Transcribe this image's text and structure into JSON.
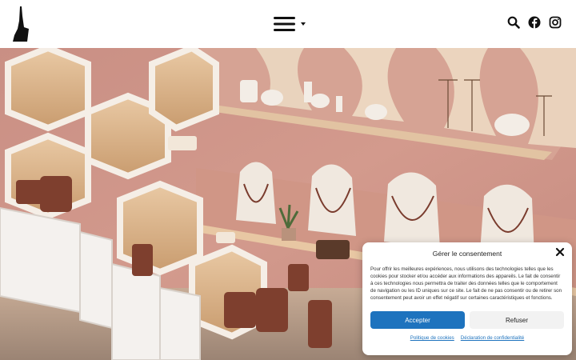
{
  "header": {
    "logo": "logo",
    "menu": {
      "icon": "hamburger-menu-icon",
      "dropdown": "caret-down-icon"
    },
    "tools": [
      "search-icon",
      "facebook-icon",
      "instagram-icon"
    ]
  },
  "hero": {
    "image": "jewelry-store-hexagonal-shelves"
  },
  "cookie": {
    "title": "Gérer le consentement",
    "body": "Pour offrir les meilleures expériences, nous utilisons des technologies telles que les cookies pour stocker et/ou accéder aux informations des appareils. Le fait de consentir à ces technologies nous permettra de traiter des données telles que le comportement de navigation ou les ID uniques sur ce site. Le fait de ne pas consentir ou de retirer son consentement peut avoir un effet négatif sur certaines caractéristiques et fonctions.",
    "accept": "Accepter",
    "refuse": "Refuser",
    "link_cookies": "Politique de cookies",
    "link_privacy": "Déclaration de confidentialité",
    "accent": "#1e73be"
  }
}
